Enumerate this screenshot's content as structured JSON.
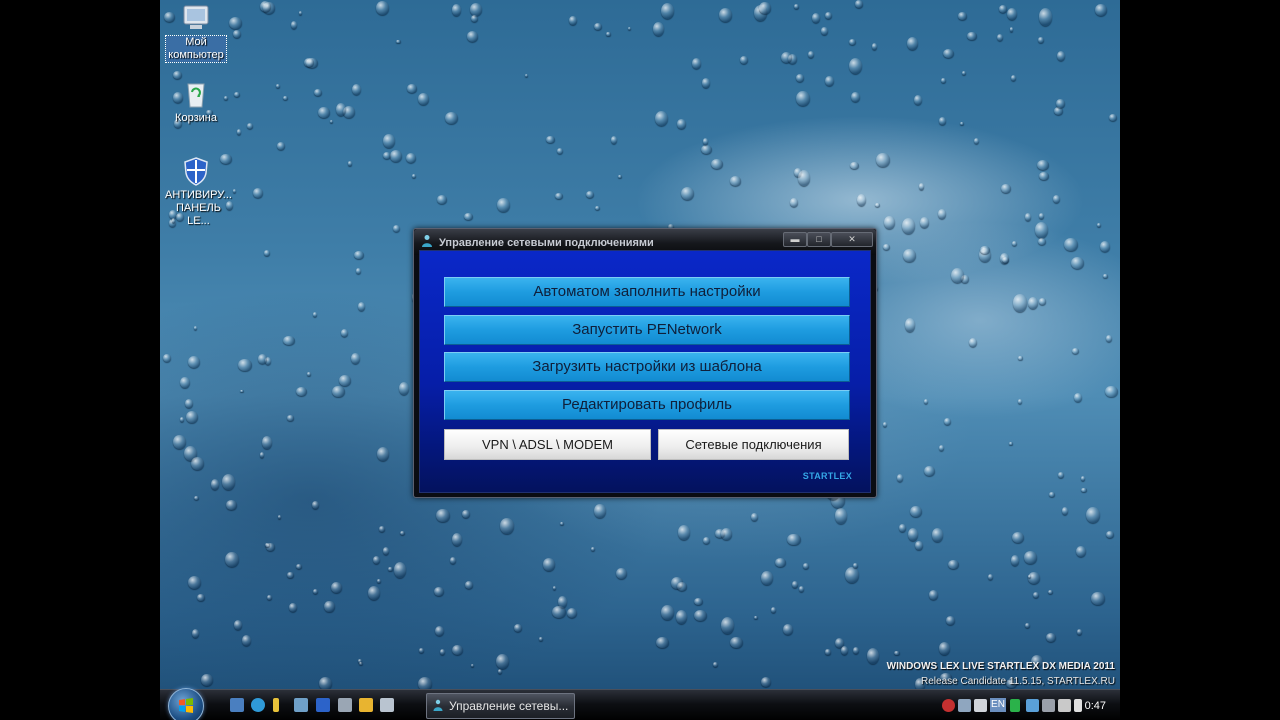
{
  "desktop": {
    "icons": [
      {
        "label_line1": "Мой",
        "label_line2": "компьютер",
        "icon": "my-computer-icon"
      },
      {
        "label_line1": "Корзина",
        "label_line2": "",
        "icon": "recycle-bin-icon"
      },
      {
        "label_line1": "АНТИВИРУ...",
        "label_line2": "ПАНЕЛЬ LE...",
        "icon": "shield-icon"
      }
    ],
    "watermark": {
      "line1": "WINDOWS LEX LIVE STARTLEX DX MEDIA 2011",
      "line2": "Release Candidate 11.5.15, STARTLEX.RU"
    }
  },
  "window": {
    "title": "Управление сетевыми подключениями",
    "buttons": {
      "auto_fill": "Автоматом заполнить настройки",
      "run_penetwork": "Запустить PENetwork",
      "load_template": "Загрузить настройки из шаблона",
      "edit_profile": "Редактировать профиль",
      "vpn": "VPN \\ ADSL \\ MODEM",
      "network_connections": "Сетевые подключения"
    },
    "brand": "STARTLEX",
    "caption": {
      "minimize": "▬",
      "maximize": "□",
      "close": "✕"
    }
  },
  "taskbar": {
    "task_label": "Управление сетевы...",
    "language": "EN",
    "clock": "0:47"
  },
  "colors": {
    "client_bg": "#0a28c8",
    "button_blue": "#1e9ce0",
    "brand_text": "#35a7e6"
  }
}
